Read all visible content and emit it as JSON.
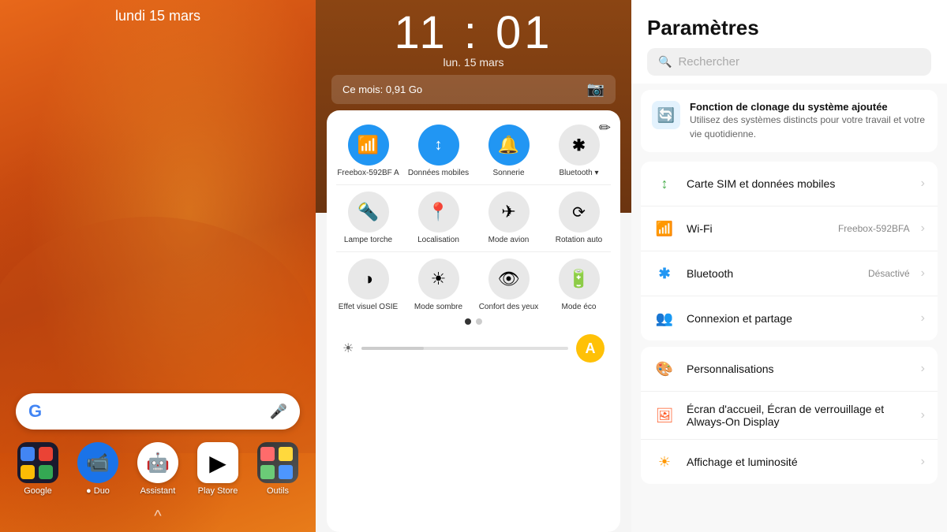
{
  "panel1": {
    "date": "lundi 15 mars",
    "search_placeholder": "G",
    "apps": [
      {
        "id": "google",
        "label": "Google",
        "type": "google-apps"
      },
      {
        "id": "duo",
        "label": "● Duo",
        "type": "duo"
      },
      {
        "id": "assistant",
        "label": "Assistant",
        "type": "assistant"
      },
      {
        "id": "playstore",
        "label": "Play Store",
        "type": "playstore"
      },
      {
        "id": "outils",
        "label": "Outils",
        "type": "outils"
      }
    ]
  },
  "panel2": {
    "time": "11 : 01",
    "date": "lun. 15 mars",
    "data_usage": "Ce mois: 0,91 Go",
    "qs_items": [
      {
        "id": "wifi",
        "label": "Freebox-592BF A",
        "icon": "📶",
        "active": true
      },
      {
        "id": "data",
        "label": "Données mobile",
        "icon": "↕",
        "active": true
      },
      {
        "id": "sound",
        "label": "Sonnerie",
        "icon": "🔔",
        "active": true
      },
      {
        "id": "bluetooth",
        "label": "Bluetooth ▾",
        "icon": "✱",
        "active": false
      },
      {
        "id": "torch",
        "label": "Lampe torche",
        "icon": "🔦",
        "active": false
      },
      {
        "id": "location",
        "label": "Localisation",
        "icon": "📍",
        "active": false
      },
      {
        "id": "airplane",
        "label": "Mode avion",
        "icon": "✈",
        "active": false
      },
      {
        "id": "rotation",
        "label": "Rotation auto",
        "icon": "⟳",
        "active": false
      },
      {
        "id": "osie",
        "label": "Effet visuel OSIE",
        "icon": "◑",
        "active": false
      },
      {
        "id": "dark",
        "label": "Mode sombre",
        "icon": "☀",
        "active": false
      },
      {
        "id": "comfort",
        "label": "Confort des yeux",
        "icon": "👁",
        "active": false
      },
      {
        "id": "eco",
        "label": "Mode éco",
        "icon": "🔋",
        "active": false
      }
    ],
    "user_avatar": "A"
  },
  "panel3": {
    "title": "Paramètres",
    "search_placeholder": "Rechercher",
    "promo": {
      "title": "Fonction de clonage du système ajoutée",
      "desc": "Utilisez des systèmes distincts pour votre travail et votre vie quotidienne."
    },
    "items": [
      {
        "icon": "↕",
        "color": "#4CAF50",
        "label": "Carte SIM et données mobiles",
        "value": ""
      },
      {
        "icon": "📶",
        "color": "#2196F3",
        "label": "Wi-Fi",
        "value": "Freebox-592BFA"
      },
      {
        "icon": "✱",
        "color": "#2196F3",
        "label": "Bluetooth",
        "value": "Désactivé"
      },
      {
        "icon": "👥",
        "color": "#4CAF50",
        "label": "Connexion et partage",
        "value": ""
      },
      {
        "icon": "🎨",
        "color": "#FF9800",
        "label": "Personnalisations",
        "value": ""
      },
      {
        "icon": "🖼",
        "color": "#FF5722",
        "label": "Écran d'accueil, Écran de verrouillage et Always-On Display",
        "value": ""
      },
      {
        "icon": "☀",
        "color": "#FF9800",
        "label": "Affichage et luminosité",
        "value": ""
      }
    ]
  }
}
